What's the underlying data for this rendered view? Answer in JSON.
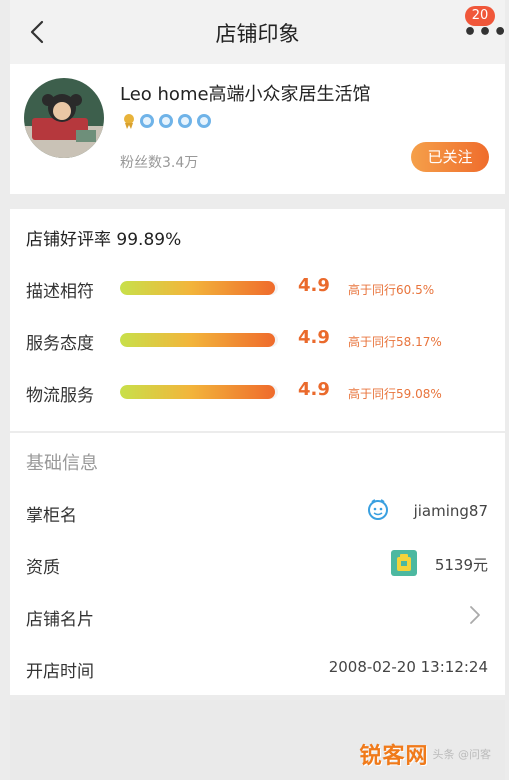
{
  "navbar": {
    "title": "店铺印象",
    "badge_count": "20",
    "back_icon": "chevron-left-icon",
    "more_icon": "more-dots-icon"
  },
  "shop": {
    "name": "Leo home高端小众家居生活馆",
    "fans": "粉丝数3.4万",
    "follow_label": "已关注",
    "rank_icons": [
      "medal-icon",
      "crown-icon",
      "crown-icon",
      "crown-icon",
      "crown-icon"
    ]
  },
  "ratings": {
    "good_rate": "店铺好评率 99.89%",
    "items": [
      {
        "label": "描述相符",
        "score": "4.9",
        "compare": "高于同行60.5%",
        "fill": 0.98
      },
      {
        "label": "服务态度",
        "score": "4.9",
        "compare": "高于同行58.17%",
        "fill": 0.98
      },
      {
        "label": "物流服务",
        "score": "4.9",
        "compare": "高于同行59.08%",
        "fill": 0.98
      }
    ]
  },
  "info": {
    "section_title": "基础信息",
    "rows": [
      {
        "label": "掌柜名",
        "value": "jiaming87",
        "icon": "wangwang-chat-icon"
      },
      {
        "label": "资质",
        "value": "5139元",
        "icon": "deposit-shield-icon"
      },
      {
        "label": "店铺名片",
        "value": "",
        "icon": "chevron-right-icon"
      },
      {
        "label": "开店时间",
        "value": "2008-02-20 13:12:24",
        "icon": ""
      }
    ]
  },
  "watermark": {
    "main": "锐客网",
    "sub": "头条 @问客"
  },
  "colors": {
    "accent": "#ef6c2c",
    "score": "#ea6a2c",
    "badge": "#f0573a"
  }
}
